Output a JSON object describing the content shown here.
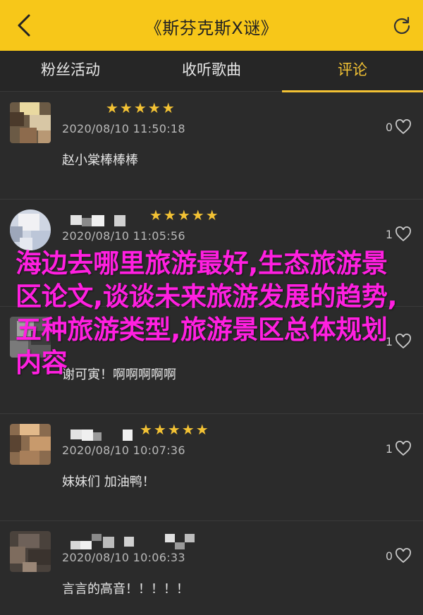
{
  "header": {
    "title": "《斯芬克斯Ⅹ谜》",
    "accent_color": "#f7c719",
    "back_icon": "chevron-left-icon",
    "refresh_icon": "refresh-icon"
  },
  "tabs": [
    {
      "label": "粉丝活动",
      "active": false
    },
    {
      "label": "收听歌曲",
      "active": false
    },
    {
      "label": "评论",
      "active": true
    }
  ],
  "comments": [
    {
      "stars": "★★★★★",
      "date": "2020/08/10 11:50:18",
      "likes": "0",
      "text": "赵小棠棒棒棒"
    },
    {
      "stars": "★★★★★",
      "date": "2020/08/10 11:05:56",
      "likes": "1",
      "text": ""
    },
    {
      "stars": "★★★★★",
      "date": "",
      "likes": "1",
      "text": "谢可寅！啊啊啊啊啊"
    },
    {
      "stars": "★★★★★",
      "date": "2020/08/10 10:07:36",
      "likes": "1",
      "text": "妹妹们 加油鸭！"
    },
    {
      "stars": "",
      "date": "2020/08/10 10:06:33",
      "likes": "0",
      "text": "言言的高音！！！！！"
    }
  ],
  "overlay_text": "海边去哪里旅游最好,生态旅游景区论文,谈谈未来旅游发展的趋势,五种旅游类型,旅游景区总体规划内容"
}
